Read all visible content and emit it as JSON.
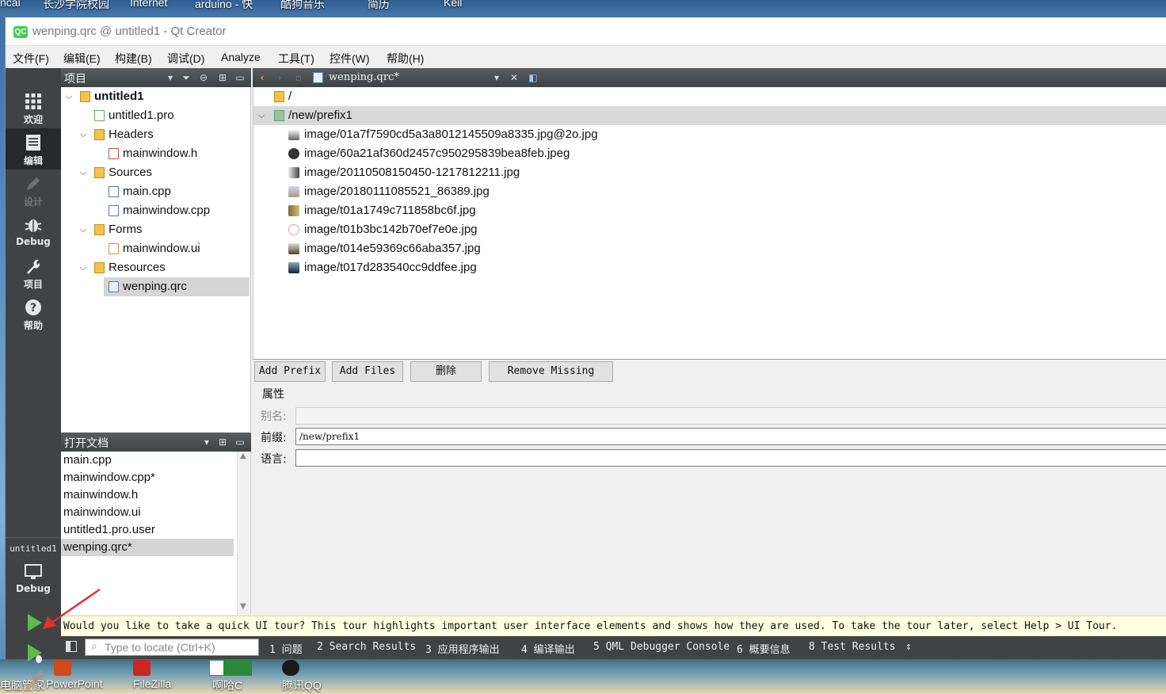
{
  "desktop": {
    "top_icons": [
      "ncai",
      "长沙学院校园",
      "Internet",
      "arduino - 快",
      "酷狗音乐",
      "简历",
      "Keil"
    ],
    "bottom_icons": [
      "电脑管家",
      "PowerPoint",
      "FileZilla",
      "啊哈C",
      "腾讯QQ"
    ]
  },
  "window": {
    "title": "wenping.qrc @ untitled1 - Qt Creator",
    "logo": "QC"
  },
  "menu": [
    "文件(F)",
    "编辑(E)",
    "构建(B)",
    "调试(D)",
    "Analyze",
    "工具(T)",
    "控件(W)",
    "帮助(H)"
  ],
  "modes": [
    {
      "label": "欢迎",
      "icon": "grid-icon"
    },
    {
      "label": "编辑",
      "icon": "document-icon"
    },
    {
      "label": "设计",
      "icon": "pencil-icon"
    },
    {
      "label": "Debug",
      "icon": "bug-icon"
    },
    {
      "label": "项目",
      "icon": "wrench-icon"
    },
    {
      "label": "帮助",
      "icon": "help-icon"
    }
  ],
  "kit": {
    "project": "untitled1",
    "mode": "Debug"
  },
  "project_pane": {
    "title": "项目",
    "tree": [
      {
        "label": "untitled1"
      },
      {
        "label": "untitled1.pro"
      },
      {
        "label": "Headers"
      },
      {
        "label": "mainwindow.h"
      },
      {
        "label": "Sources"
      },
      {
        "label": "main.cpp"
      },
      {
        "label": "mainwindow.cpp"
      },
      {
        "label": "Forms"
      },
      {
        "label": "mainwindow.ui"
      },
      {
        "label": "Resources"
      },
      {
        "label": "wenping.qrc"
      }
    ]
  },
  "open_docs": {
    "title": "打开文档",
    "items": [
      "main.cpp",
      "mainwindow.cpp*",
      "mainwindow.h",
      "mainwindow.ui",
      "untitled1.pro.user",
      "wenping.qrc*"
    ]
  },
  "editor": {
    "current_file": "wenping.qrc*",
    "root": "/",
    "prefix": "/new/prefix1",
    "files": [
      "image/01a7f7590cd5a3a8012145509a8335.jpg@2o.jpg",
      "image/60a21af360d2457c950295839bea8feb.jpeg",
      "image/20110508150450-1217812211.jpg",
      "image/20180111085521_86389.jpg",
      "image/t01a1749c711858bc6f.jpg",
      "image/t01b3bc142b70ef7e0e.jpg",
      "image/t014e59369c66aba357.jpg",
      "image/t017d283540cc9ddfee.jpg"
    ],
    "buttons": {
      "add_prefix": "Add Prefix",
      "add_files": "Add Files",
      "delete": "删除",
      "remove_missing": "Remove Missing Files"
    },
    "properties": {
      "title": "属性",
      "alias_label": "别名:",
      "alias_value": "",
      "prefix_label": "前缀:",
      "prefix_value": "/new/prefix1",
      "lang_label": "语言:",
      "lang_value": ""
    }
  },
  "tour": "Would you like to take a quick UI tour? This tour highlights important user interface elements and shows how they are used. To take the tour later, select Help > UI Tour.",
  "statusbar": {
    "locator_placeholder": "Type to locate (Ctrl+K)",
    "tabs": [
      "1 问题",
      "2 Search Results",
      "3 应用程序输出",
      "4 编译输出",
      "5 QML Debugger Console",
      "6 概要信息",
      "8 Test Results"
    ]
  },
  "colors": {
    "mode_bar": "#404244",
    "run_green": "#5dba4b",
    "annotation_red": "#e03030"
  }
}
